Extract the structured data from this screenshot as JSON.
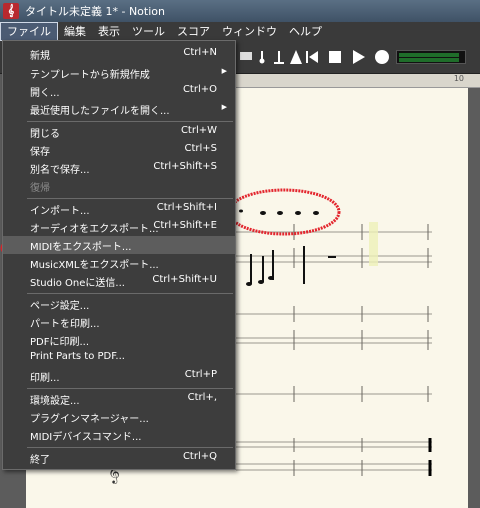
{
  "window": {
    "title": "タイトル未定義 1* - Notion"
  },
  "menubar": [
    "ファイル",
    "編集",
    "表示",
    "ツール",
    "スコア",
    "ウィンドウ",
    "ヘルプ"
  ],
  "ruler": {
    "number": "10"
  },
  "file_menu": {
    "items": [
      {
        "label": "新規",
        "shortcut": "Ctrl+N"
      },
      {
        "label": "テンプレートから新規作成",
        "shortcut": "",
        "submenu": true
      },
      {
        "label": "開く...",
        "shortcut": "Ctrl+O"
      },
      {
        "label": "最近使用したファイルを開く...",
        "shortcut": "",
        "submenu": true
      },
      {
        "label": "閉じる",
        "shortcut": "Ctrl+W"
      },
      {
        "label": "保存",
        "shortcut": "Ctrl+S"
      },
      {
        "label": "別名で保存...",
        "shortcut": "Ctrl+Shift+S"
      },
      {
        "label": "復帰",
        "shortcut": "",
        "disabled": true
      },
      {
        "label": "インポート...",
        "shortcut": "Ctrl+Shift+I"
      },
      {
        "label": "オーディオをエクスポート...",
        "shortcut": "Ctrl+Shift+E"
      },
      {
        "label": "MIDIをエクスポート...",
        "shortcut": "",
        "highlighted": true
      },
      {
        "label": "MusicXMLをエクスポート...",
        "shortcut": ""
      },
      {
        "label": "Studio Oneに送信...",
        "shortcut": "Ctrl+Shift+U"
      },
      {
        "label": "ページ設定...",
        "shortcut": ""
      },
      {
        "label": "パートを印刷...",
        "shortcut": ""
      },
      {
        "label": "PDFに印刷...",
        "shortcut": ""
      },
      {
        "label": "Print Parts to PDF...",
        "shortcut": ""
      },
      {
        "label": "印刷...",
        "shortcut": "Ctrl+P"
      },
      {
        "label": "環境設定...",
        "shortcut": "Ctrl+,"
      },
      {
        "label": "プラグインマネージャー...",
        "shortcut": ""
      },
      {
        "label": "MIDIデバイスコマンド...",
        "shortcut": ""
      },
      {
        "label": "終了",
        "shortcut": "Ctrl+Q"
      }
    ]
  },
  "colors": {
    "menu_bg": "#3d3d3d",
    "paper": "#faf7ea",
    "annotation": "#e3262e"
  }
}
